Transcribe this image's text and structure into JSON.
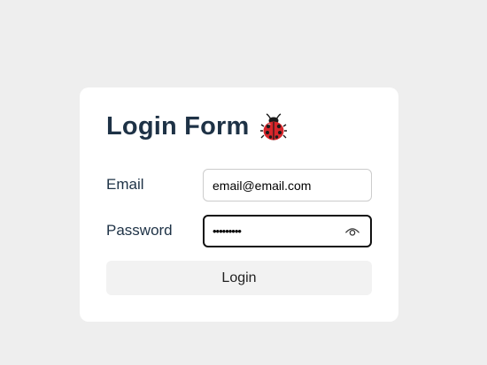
{
  "form": {
    "title": "Login Form",
    "title_icon": "ladybug-icon",
    "email_label": "Email",
    "email_value": "email@email.com",
    "password_label": "Password",
    "password_value": "123456789",
    "toggle_icon": "eye-icon",
    "submit_label": "Login"
  },
  "colors": {
    "page_background": "#eeeeee",
    "card_background": "#ffffff",
    "title_text": "#1e3246",
    "button_background": "#f2f2f2",
    "focused_border": "#111111",
    "ladybug_red": "#d8262b"
  }
}
